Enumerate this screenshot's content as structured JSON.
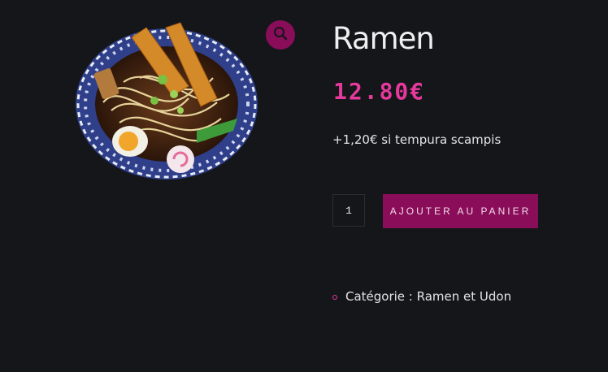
{
  "product": {
    "image_alt": "Ramen",
    "title": "Ramen",
    "price": "12.80€",
    "note": "+1,20€ si tempura scampis",
    "quantity": "1",
    "add_to_cart_label": "Ajouter au panier",
    "category_text": "Catégorie : Ramen et Udon"
  },
  "icons": {
    "zoom": "magnifier-icon",
    "bullet": "bullet-icon"
  },
  "colors": {
    "background": "#14161a",
    "accent": "#8a0d5a",
    "price": "#e6399c"
  }
}
